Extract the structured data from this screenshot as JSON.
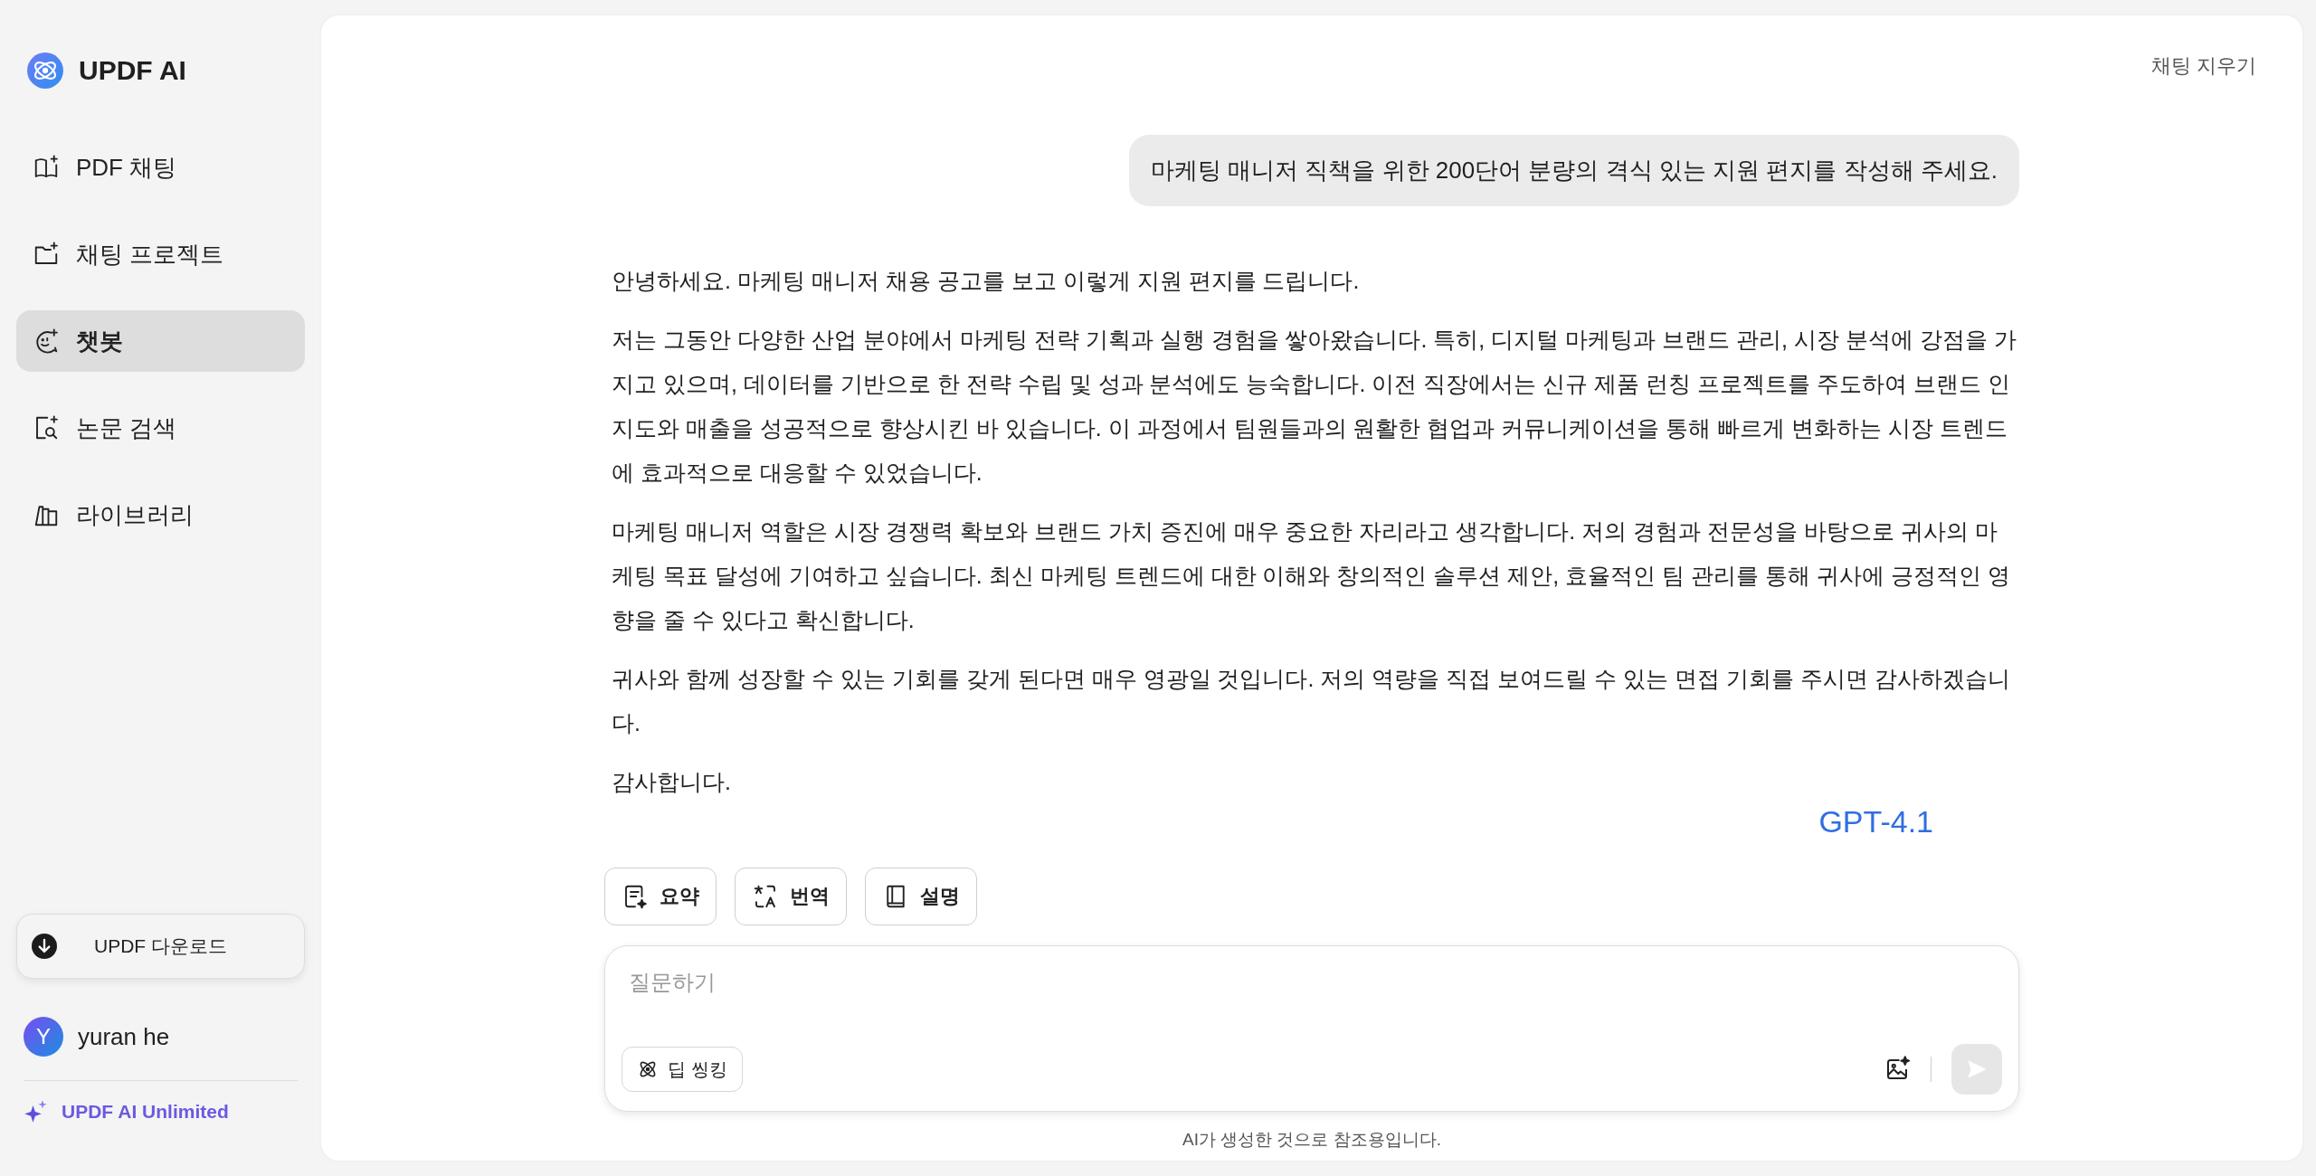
{
  "sidebar": {
    "logo": "UPDF AI",
    "items": [
      {
        "label": "PDF 채팅",
        "kind": "book",
        "selected": false
      },
      {
        "label": "채팅 프로젝트",
        "kind": "folder",
        "selected": false
      },
      {
        "label": "챗봇",
        "kind": "bot",
        "selected": true
      },
      {
        "label": "논문 검색",
        "kind": "search",
        "selected": false
      },
      {
        "label": "라이브러리",
        "kind": "library",
        "selected": false
      }
    ],
    "download_button": "UPDF 다운로드",
    "user": {
      "initial": "Y",
      "name": "yuran he"
    },
    "upgrade": "UPDF AI Unlimited"
  },
  "header": {
    "clear_button": "채팅 지우기"
  },
  "messages": [
    {
      "kind": "user",
      "text": "마케팅 매니저 직책을 위한 200단어 분량의 격식 있는 지원 편지를 작성해 주세요."
    },
    {
      "kind": "assistant",
      "model": "GPT-4.1",
      "paragraphs": [
        "안녕하세요. 마케팅 매니저 채용 공고를 보고 이렇게 지원 편지를 드립니다.",
        "저는 그동안 다양한 산업 분야에서 마케팅 전략 기획과 실행 경험을 쌓아왔습니다. 특히, 디지털 마케팅과 브랜드 관리, 시장 분석에 강점을 가지고 있으며, 데이터를 기반으로 한 전략 수립 및 성과 분석에도 능숙합니다. 이전 직장에서는 신규 제품 런칭 프로젝트를 주도하여 브랜드 인지도와 매출을 성공적으로 향상시킨 바 있습니다. 이 과정에서 팀원들과의 원활한 협업과 커뮤니케이션을 통해 빠르게 변화하는 시장 트렌드에 효과적으로 대응할 수 있었습니다.",
        "마케팅 매니저 역할은 시장 경쟁력 확보와 브랜드 가치 증진에 매우 중요한 자리라고 생각합니다. 저의 경험과 전문성을 바탕으로 귀사의 마케팅 목표 달성에 기여하고 싶습니다. 최신 마케팅 트렌드에 대한 이해와 창의적인 솔루션 제안, 효율적인 팀 관리를 통해 귀사에 긍정적인 영향을 줄 수 있다고 확신합니다.",
        "귀사와 함께 성장할 수 있는 기회를 갖게 된다면 매우 영광일 것입니다. 저의 역량을 직접 보여드릴 수 있는 면접 기회를 주시면 감사하겠습니다.",
        "감사합니다."
      ]
    }
  ],
  "actions": [
    {
      "label": "요약",
      "kind": "summary"
    },
    {
      "label": "번역",
      "kind": "translate"
    },
    {
      "label": "설명",
      "kind": "explain"
    }
  ],
  "composer": {
    "placeholder": "질문하기",
    "deep_thinking": "딥 씽킹",
    "send_disabled": true
  },
  "disclaimer": "AI가 생성한 것으로 참조용입니다."
}
